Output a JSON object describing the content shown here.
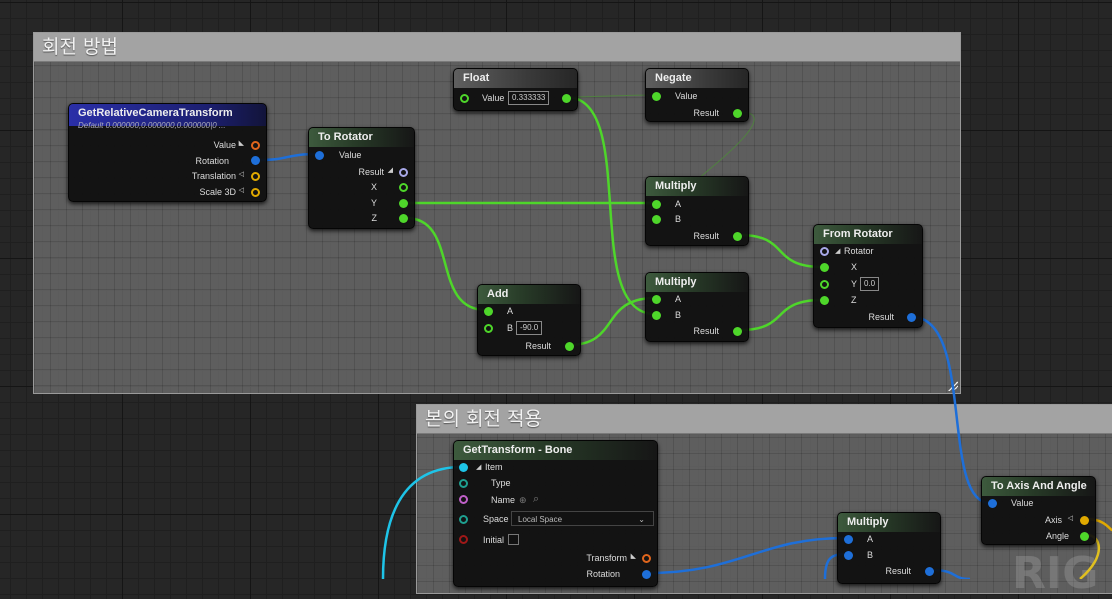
{
  "comments": {
    "rotation_method": "회전 방법",
    "bone_rotation_apply": "본의 회전 적용"
  },
  "nodes": {
    "get_camera": {
      "title": "GetRelativeCameraTransform",
      "subtitle": "Default 0.000000,0.000000,0.000000|0 ...",
      "pins": [
        "Value",
        "Rotation",
        "Translation",
        "Scale 3D"
      ]
    },
    "to_rotator": {
      "title": "To Rotator",
      "pins": [
        "Value",
        "Result",
        "X",
        "Y",
        "Z"
      ]
    },
    "float": {
      "title": "Float",
      "value_label": "Value",
      "value": "0.333333"
    },
    "negate": {
      "title": "Negate",
      "value_label": "Value",
      "result_label": "Result"
    },
    "multiply1": {
      "title": "Multiply",
      "a": "A",
      "b": "B",
      "result": "Result"
    },
    "multiply2": {
      "title": "Multiply",
      "a": "A",
      "b": "B",
      "result": "Result"
    },
    "add": {
      "title": "Add",
      "a": "A",
      "b": "B",
      "b_value": "-90.0",
      "result": "Result"
    },
    "from_rotator": {
      "title": "From Rotator",
      "rotator": "Rotator",
      "x": "X",
      "y": "Y",
      "y_value": "0.0",
      "z": "Z",
      "result": "Result"
    },
    "get_transform_bone": {
      "title": "GetTransform - Bone",
      "item": "Item",
      "type": "Type",
      "name": "Name",
      "space": "Space",
      "space_value": "Local Space",
      "initial": "Initial",
      "transform": "Transform",
      "rotation": "Rotation"
    },
    "multiply3": {
      "title": "Multiply",
      "a": "A",
      "b": "B",
      "result": "Result"
    },
    "to_axis_angle": {
      "title": "To Axis And Angle",
      "value": "Value",
      "axis": "Axis",
      "angle": "Angle"
    }
  },
  "colors": {
    "float_pin": "#4ed62a",
    "rotator_pin": "#a8a8e8",
    "quat_pin": "#1e6fd9",
    "vector_pin": "#e0a900",
    "transform_pin": "#e0651c",
    "struct_pin": "#1ec4e8"
  }
}
